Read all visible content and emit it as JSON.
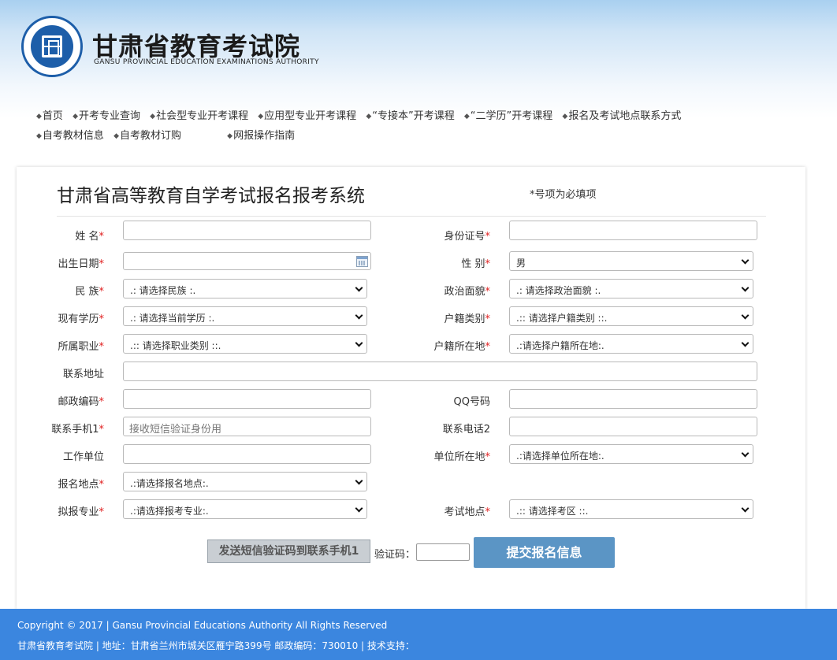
{
  "header": {
    "title": "甘肃省教育考试院",
    "subtitle": "GANSU PROVINCIAL EDUCATION EXAMINATIONS AUTHORITY",
    "seal_text": "甘肃省教育考试院"
  },
  "nav": {
    "row1": [
      "首页",
      "开考专业查询",
      "社会型专业开考课程",
      "应用型专业开考课程",
      "“专接本”开考课程",
      "“二学历”开考课程",
      "报名及考试地点联系方式"
    ],
    "row2": [
      "自考教材信息",
      "自考教材订购",
      "网报操作指南"
    ]
  },
  "form": {
    "title": "甘肃省高等教育自学考试报名报考系统",
    "required_note": "*号项为必填项",
    "star": "*",
    "labels": {
      "name": "姓 名",
      "id_number": "身份证号",
      "birth_date": "出生日期",
      "gender": "性 别",
      "ethnicity": "民 族",
      "political_status": "政治面貌",
      "education": "现有学历",
      "household_type": "户籍类别",
      "occupation": "所属职业",
      "household_location": "户籍所在地",
      "address": "联系地址",
      "postal_code": "邮政编码",
      "qq": "QQ号码",
      "mobile1": "联系手机1",
      "phone2": "联系电话2",
      "employer": "工作单位",
      "employer_location": "单位所在地",
      "registration_site": "报名地点",
      "major": "拟报专业",
      "exam_site": "考试地点"
    },
    "values": {
      "gender": "男",
      "ethnicity": ".: 请选择民族 :.",
      "political_status": ".: 请选择政治面貌 :.",
      "education": ".: 请选择当前学历 :.",
      "household_type": ".:: 请选择户籍类别 ::.",
      "occupation": ".:: 请选择职业类别 ::.",
      "household_location": ".:请选择户籍所在地:.",
      "employer_location": ".:请选择单位所在地:.",
      "registration_site": ".:请选择报名地点:.",
      "major": ".:请选择报考专业:.",
      "exam_site": ".:: 请选择考区 ::."
    },
    "placeholders": {
      "mobile1": "接收短信验证身份用"
    },
    "buttons": {
      "send_sms": "发送短信验证码到联系手机1",
      "verification_label": "验证码：",
      "submit": "提交报名信息"
    }
  },
  "footer": {
    "copyright": "Copyright © 2017 | Gansu Provincial Educations Authority All Rights Reserved",
    "address": "甘肃省教育考试院 | 地址：甘肃省兰州市城关区雁宁路399号 邮政编码：730010 | 技术支持："
  },
  "colors": {
    "footer_bg": "#3b86df",
    "submit_bg": "#5b95c5",
    "required_star": "#e02020",
    "logo_blue": "#1d5ea9"
  }
}
